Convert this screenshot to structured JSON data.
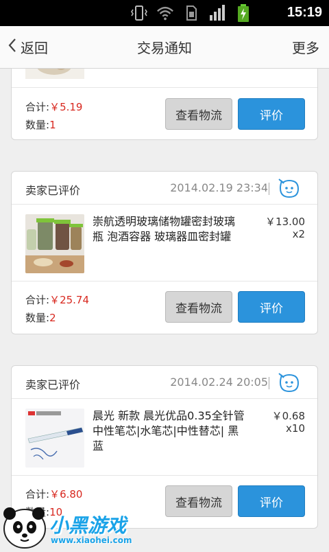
{
  "statusbar": {
    "time": "15:19",
    "icons": [
      "vibrate-icon",
      "wifi-icon",
      "sim-icon",
      "signal-icon",
      "battery-charging-icon"
    ]
  },
  "nav": {
    "back_label": "返回",
    "title": "交易通知",
    "more_label": "更多"
  },
  "labels": {
    "total": "合计:",
    "count": "数量:",
    "logistics_button": "查看物流",
    "review_button": "评价"
  },
  "cards": [
    {
      "total": "￥5.19",
      "count": "1"
    },
    {
      "status": "卖家已评价",
      "date": "2014.02.19 23:34",
      "product_name": "崇航透明玻璃储物罐密封玻璃瓶 泡酒容器 玻璃器皿密封罐",
      "price": "￥13.00",
      "qty": "x2",
      "total": "￥25.74",
      "count": "2"
    },
    {
      "status": "卖家已评价",
      "date": "2014.02.24 20:05",
      "product_name": "晨光 新款 晨光优品0.35全针管中性笔芯|水笔芯|中性替芯| 黑 蓝",
      "price": "￥0.68",
      "qty": "x10",
      "total": "￥6.80",
      "count": "10"
    }
  ],
  "watermark": {
    "brand": "小黑游戏",
    "url": "www.xiaohei.com"
  },
  "colors": {
    "accent_blue": "#2b93dc",
    "price_red": "#d8281f"
  }
}
